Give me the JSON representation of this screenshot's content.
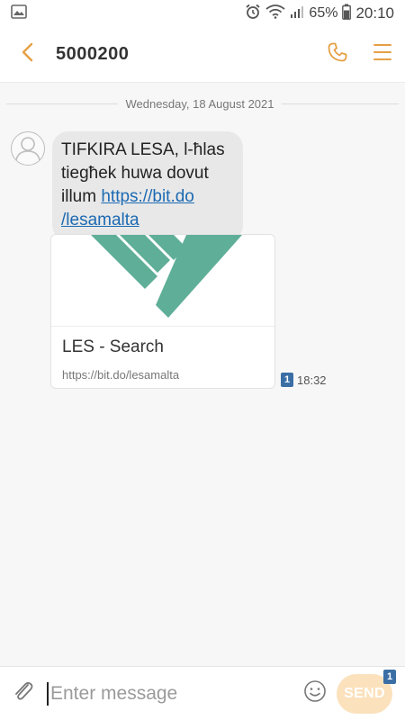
{
  "status_bar": {
    "battery": "65%",
    "time": "20:10",
    "icons": [
      "image-icon",
      "alarm-icon",
      "wifi-icon",
      "signal-icon",
      "battery-icon"
    ]
  },
  "header": {
    "title": "5000200",
    "icons": [
      "back-chevron-icon",
      "phone-icon",
      "menu-icon"
    ],
    "accent": "#e6a045"
  },
  "conversation": {
    "date": "Wednesday, 18 August 2021",
    "message": {
      "text": "TIFKIRA LESA, l-ħlas tiegħek huwa dovut illum",
      "link": "https://bit.do/lesamalta",
      "link_line1": "https://bit.do",
      "link_line2": "/lesamalta",
      "time": "18:32",
      "sim": "1"
    },
    "preview": {
      "title": "LES - Search",
      "url": "https://bit.do/lesamalta",
      "logo_color": "#5fae98"
    }
  },
  "composer": {
    "placeholder": "Enter message",
    "send_label": "SEND",
    "sim": "1",
    "send_color": "#fbe1bc"
  }
}
